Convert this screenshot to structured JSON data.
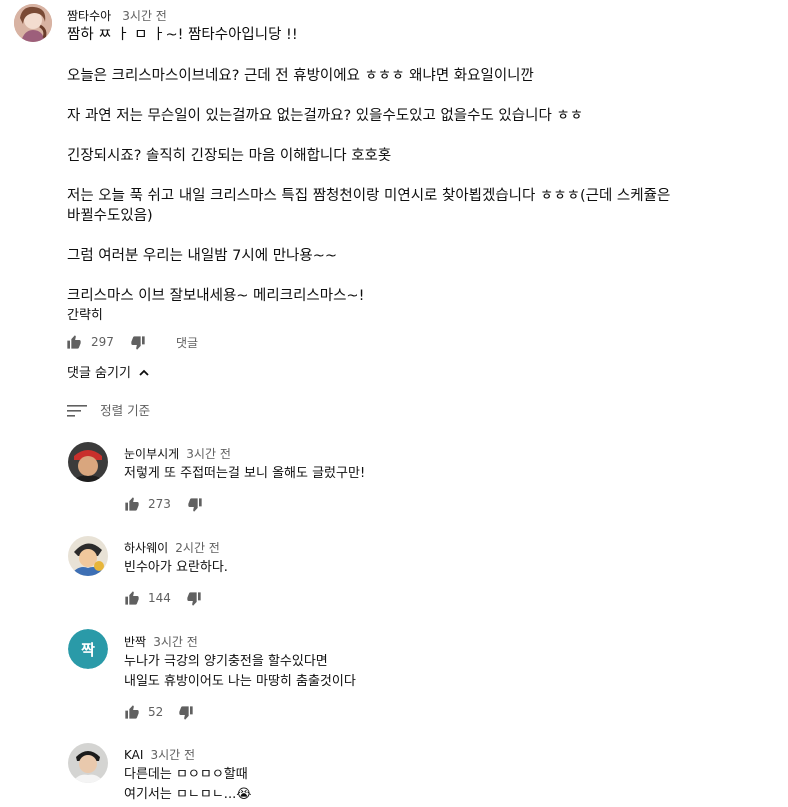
{
  "main_comment": {
    "author": "짬타수아",
    "time": "3시간 전",
    "paragraphs": [
      "짬하 ㅉ ㅏ ㅁ ㅏ~! 짬타수아입니당 !!",
      "오늘은 크리스마스이브네요? 근데 전 휴방이에요 ㅎㅎㅎ 왜냐면 화요일이니깐",
      "자 과연 저는 무슨일이 있는걸까요 없는걸까요? 있을수도있고 없을수도 있습니다 ㅎㅎ",
      "긴장되시죠? 솔직히 긴장되는 마음 이해합니다 호호홋",
      "저는 오늘 푹 쉬고 내일 크리스마스 특집 짬청천이랑 미연시로 찾아뵙겠습니다 ㅎㅎㅎ(근데 스케쥴은",
      "바뀔수도있음)",
      "그럼 여러분 우리는 내일밤 7시에 만나용~~",
      "크리스마스 이브 잘보내세용~ 메리크리스마스~!"
    ],
    "show_less": "간략히",
    "likes": "297",
    "reply_label": "댓글",
    "hide_replies": "댓글 숨기기",
    "sort_label": "정렬 기준"
  },
  "replies": [
    {
      "author": "눈이부시게",
      "time": "3시간 전",
      "lines": [
        "저렇게 또 주접떠는걸 보니 올해도 글렀구만!"
      ],
      "likes": "273"
    },
    {
      "author": "하사웨이",
      "time": "2시간 전",
      "lines": [
        "빈수아가 요란하다."
      ],
      "likes": "144"
    },
    {
      "author": "반짝",
      "time": "3시간 전",
      "avatar_letter": "짝",
      "avatar_color": "#2a9aa8",
      "lines": [
        "누나가 극강의 양기충전을 할수있다면",
        "내일도 휴방이어도 나는 마땅히 춤출것이다"
      ],
      "likes": "52"
    },
    {
      "author": "KAI",
      "time": "3시간 전",
      "lines": [
        "다른데는 ㅁㅇㅁㅇ할때",
        "여기서는 ㅁㄴㅁㄴ...😭"
      ],
      "likes": ""
    }
  ]
}
